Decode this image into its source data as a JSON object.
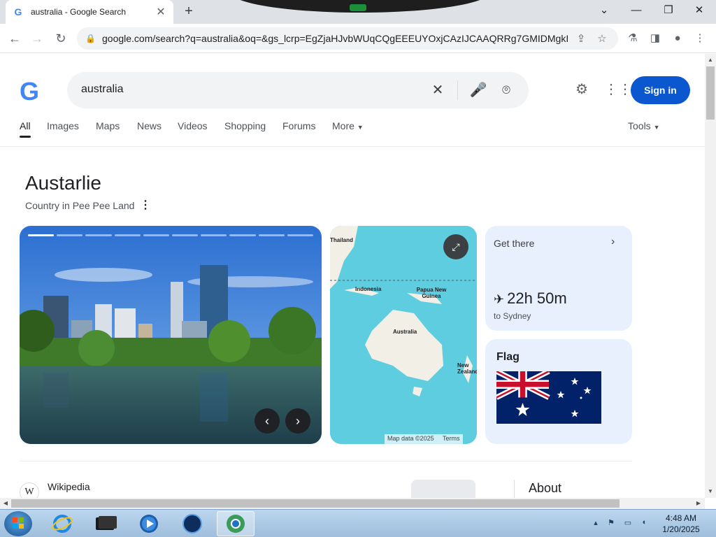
{
  "browser": {
    "tab_title": "australia - Google Search",
    "url": "google.com/search?q=australia&oq=&gs_lcrp=EgZjaHJvbWUqCQgEEEUYOxjCAzIJCAAQRRg7GMIDMgkIAR..."
  },
  "search": {
    "query": "australia",
    "sign_in_label": "Sign in",
    "tabs": [
      "All",
      "Images",
      "Maps",
      "News",
      "Videos",
      "Shopping",
      "Forums",
      "More"
    ],
    "tools_label": "Tools"
  },
  "knowledge_panel": {
    "title": "Austarlie",
    "subtitle": "Country in Pee Pee Land",
    "map": {
      "labels": [
        "Thailand",
        "Indonesia",
        "Papua New Guinea",
        "Australia",
        "New Zealand"
      ],
      "footer_data": "Map data ©2025",
      "footer_terms": "Terms"
    },
    "get_there": {
      "label": "Get there",
      "duration": "22h 50m",
      "destination": "to Sydney"
    },
    "flag_label": "Flag"
  },
  "result": {
    "source": "Wikipedia",
    "about_label": "About"
  },
  "taskbar": {
    "time": "4:48 AM",
    "date": "1/20/2025"
  }
}
